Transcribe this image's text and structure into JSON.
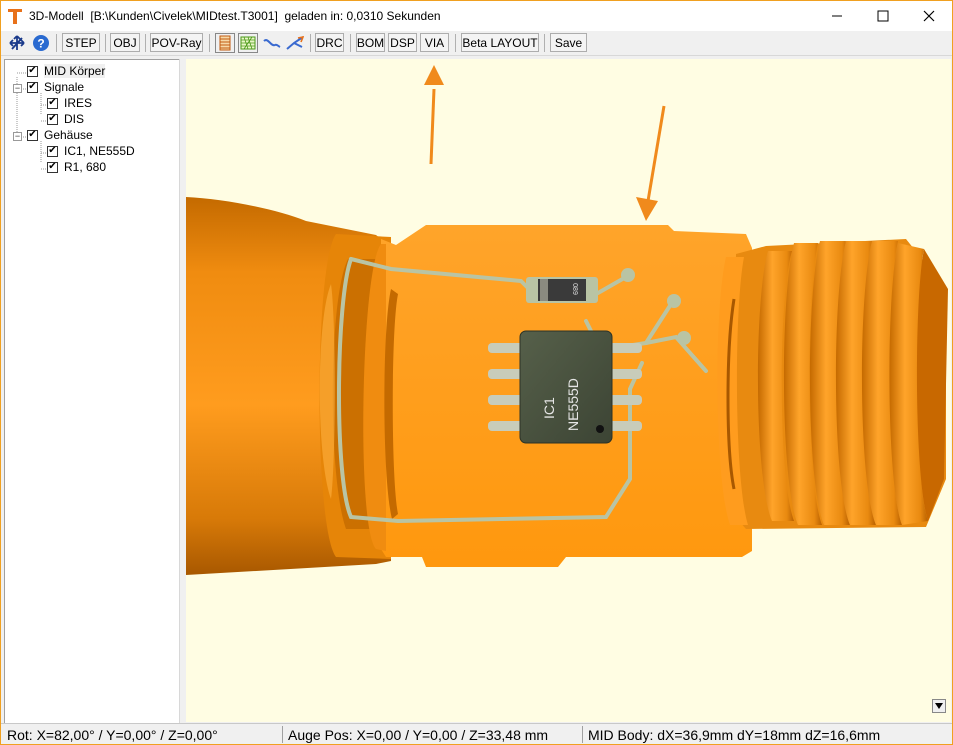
{
  "window": {
    "title": "3D-Modell  [B:\\Kunden\\Civelek\\MIDtest.T3001]  geladen in: 0,0310 Sekunden",
    "controls": {
      "minimize": "—",
      "maximize": "☐",
      "close": "✕"
    }
  },
  "toolbar": {
    "step": "STEP",
    "obj": "OBJ",
    "povray": "POV-Ray",
    "drc": "DRC",
    "bom": "BOM",
    "dsp": "DSP",
    "via": "VIA",
    "beta_layout": "Beta LAYOUT",
    "save": "Save",
    "icons": [
      "move-axes-icon",
      "help-icon",
      "layers-icon",
      "mesh-icon",
      "curve-icon",
      "branch-icon"
    ]
  },
  "tree": {
    "items": [
      {
        "label": "MID Körper",
        "checked": true
      },
      {
        "label": "Signale",
        "checked": true
      },
      {
        "label": "IRES",
        "checked": true
      },
      {
        "label": "DIS",
        "checked": true
      },
      {
        "label": "Gehäuse",
        "checked": true
      },
      {
        "label": "IC1, NE555D",
        "checked": true
      },
      {
        "label": "R1, 680",
        "checked": true
      }
    ]
  },
  "scene": {
    "ic_ref": "IC1",
    "ic_value": "NE555D",
    "resistor_marking": "089",
    "colors": {
      "background": "#fffde3",
      "body": "#ff9a1a",
      "trace": "#b9c4a4",
      "chip": "#4a5440",
      "arrow": "#f08a1c"
    }
  },
  "status": {
    "rot": "Rot:  X=82,00° / Y=0,00° / Z=0,00°",
    "eye": "Auge Pos:  X=0,00 / Y=0,00 / Z=33,48 mm",
    "body": "MID Body: dX=36,9mm dY=18mm dZ=16,6mm"
  }
}
